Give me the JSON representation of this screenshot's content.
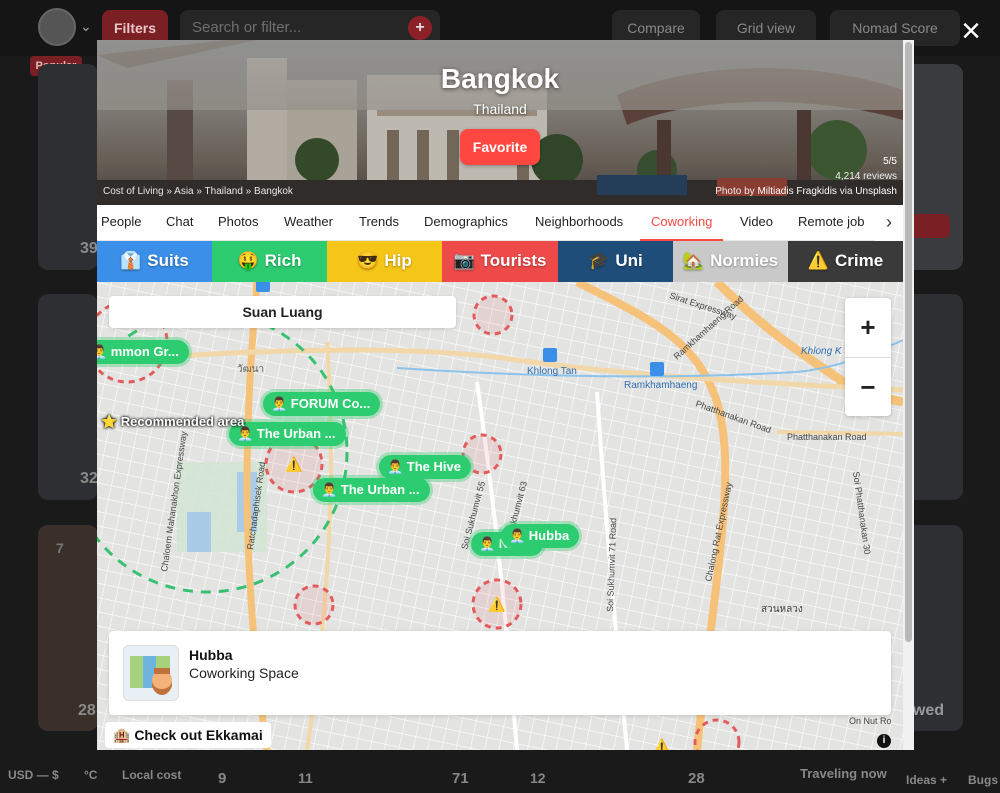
{
  "background": {
    "filters_label": "Filters",
    "search_placeholder": "Search or filter...",
    "compare_label": "Compare",
    "grid_view_label": "Grid view",
    "sort_label": "Nomad Score",
    "popular_badge": "Popular",
    "card_rank": "7",
    "stat_1": "39",
    "stat_2": "32",
    "stat_3": "28",
    "reviewed": "ewed",
    "bottom": {
      "currency": "USD — $",
      "temp_unit": "°C",
      "local_cost": "Local cost",
      "card_a_value": "9",
      "card_b_rank": "11",
      "card_b_value": "71",
      "card_c_rank": "12",
      "card_c_value": "28",
      "traveling_now": "Traveling now",
      "ideas": "Ideas +",
      "bugs": "Bugs"
    }
  },
  "modal": {
    "close_icon": "×",
    "city": "Bangkok",
    "country": "Thailand",
    "favorite_label": "Favorite",
    "breadcrumb": "Cost of Living » Asia » Thailand » Bangkok",
    "rating": "5/5",
    "reviews": "4,214 reviews",
    "photo_prefix": "Photo by",
    "photographer": "Miltiadis Fragkidis",
    "photo_via": "via",
    "photo_source": "Unsplash",
    "tabs": [
      "People",
      "Chat",
      "Photos",
      "Weather",
      "Trends",
      "Demographics",
      "Neighborhoods",
      "Coworking",
      "Video",
      "Remote job"
    ],
    "active_tab": "Coworking",
    "tab_next_icon": "›",
    "filters": [
      {
        "icon": "👔",
        "label": "Suits",
        "color": "#3b8fe8"
      },
      {
        "icon": "🤑",
        "label": "Rich",
        "color": "#2ecc71"
      },
      {
        "icon": "😎",
        "label": "Hip",
        "color": "#f5c518"
      },
      {
        "icon": "📷",
        "label": "Tourists",
        "color": "#ef4a4a"
      },
      {
        "icon": "🎓",
        "label": "Uni",
        "color": "#1f4d7a"
      },
      {
        "icon": "🏡",
        "label": "Normies",
        "color": "#c9c9c9"
      },
      {
        "icon": "⚠️",
        "label": "Crime",
        "color": "#3a3a3a"
      }
    ],
    "map": {
      "area_label": "Suan Luang",
      "zoom_in": "+",
      "zoom_out": "−",
      "recommended_label": "⭐ Recommended area",
      "pins": [
        {
          "label": "👨‍💼 mmon Gr..."
        },
        {
          "label": "👨‍💼 FORUM Co..."
        },
        {
          "label": "👨‍💼 The Urban ..."
        },
        {
          "label": "👨‍💼 The Hive"
        },
        {
          "label": "👨‍💼 The Urban ..."
        },
        {
          "label": "👨‍💼 N... ..."
        },
        {
          "label": "👨‍💼 Hubba"
        }
      ],
      "warning_icon": "⚠️",
      "map_labels": {
        "khlong_tan": "Khlong Tan",
        "ramkhamhaeng": "Ramkhamhaeng",
        "sirat_expressway": "Sirat Expressway",
        "ramkhamhaeng_road": "Ramkhamhaeng Road",
        "khlong_k": "Khlong K",
        "phatthanakan_road": "Phatthanakan Road",
        "phatthanakan_road_2": "Phatthanakan Road",
        "chaloem": "Chaloem Mahanakhon Expressway",
        "ratchadaphisek": "Ratchadaphisek Road",
        "soi_sukhumvit_55": "Soi Sukhumvit 55",
        "soi_sukhumvit_63": "Soi Sukhumvit 63",
        "soi_sukhumvit_71": "Soi Sukhumvit 71 Road",
        "chalong_rat": "Chalong Rat Expressway",
        "soi_phatthanakan_30": "Soi Phatthanakan 30",
        "suan_luang_thai": "สวนหลวง",
        "on_nut": "On Nut Ro",
        "thai_small": "วัฒนา"
      },
      "info_card": {
        "name": "Hubba",
        "type": "Coworking Space"
      },
      "ekkamai_label": "🏨 Check out Ekkamai",
      "info_icon": "i"
    }
  }
}
